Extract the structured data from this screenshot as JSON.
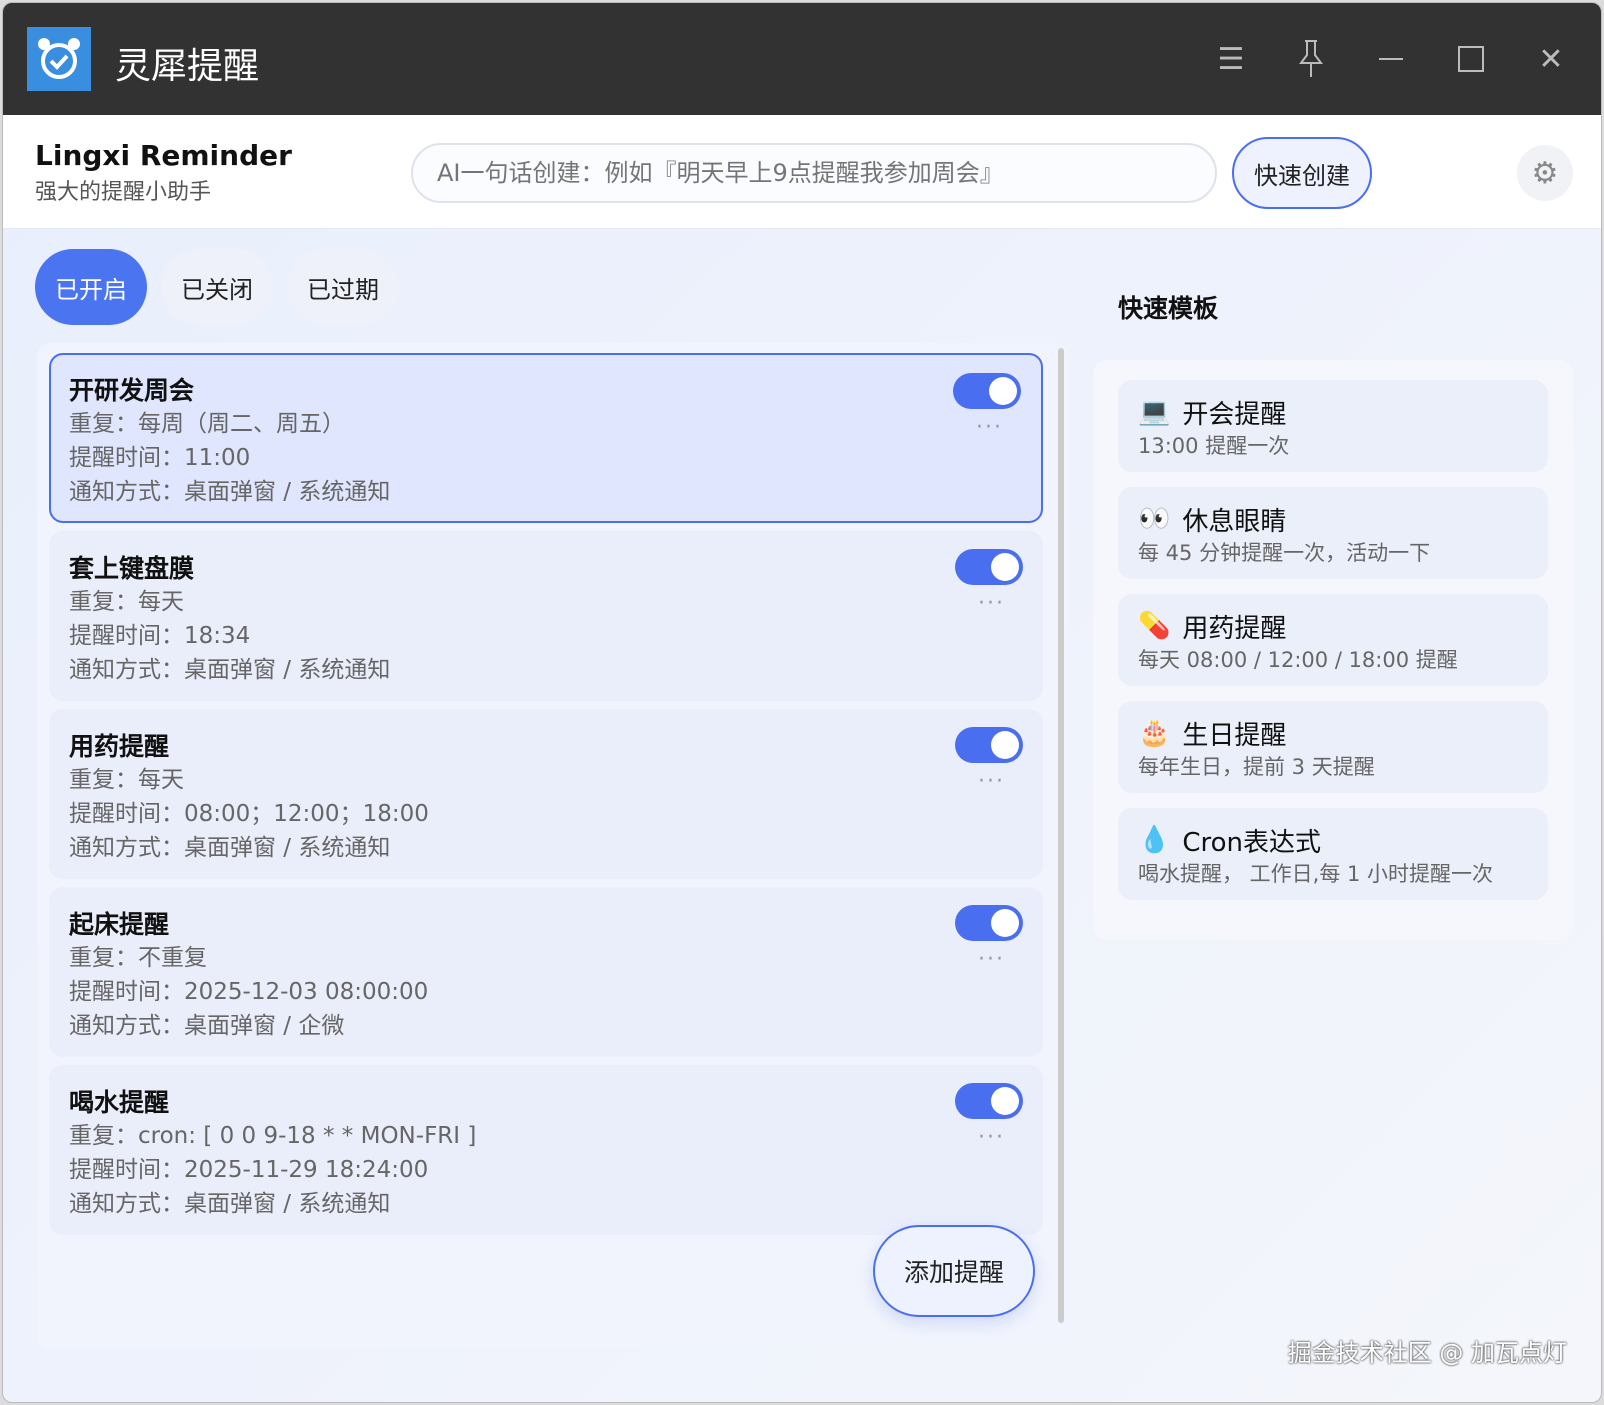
{
  "window": {
    "title": "灵犀提醒"
  },
  "header": {
    "brand": "Lingxi Reminder",
    "subtitle": "强大的提醒小助手",
    "ai_placeholder": "AI一句话创建：例如『明天早上9点提醒我参加周会』",
    "quick_create": "快速创建"
  },
  "tabs": [
    {
      "label": "已开启",
      "active": true
    },
    {
      "label": "已关闭"
    },
    {
      "label": "已过期"
    }
  ],
  "reminders": [
    {
      "title": "开研发周会",
      "repeat": "重复：每周（周二、周五）",
      "time": "提醒时间：11:00",
      "notify": "通知方式：桌面弹窗 / 系统通知",
      "enabled": true,
      "selected": true
    },
    {
      "title": "套上键盘膜",
      "repeat": "重复：每天",
      "time": "提醒时间：18:34",
      "notify": "通知方式：桌面弹窗 / 系统通知",
      "enabled": true
    },
    {
      "title": "用药提醒",
      "repeat": "重复：每天",
      "time": "提醒时间：08:00；12:00；18:00",
      "notify": "通知方式：桌面弹窗 / 系统通知",
      "enabled": true
    },
    {
      "title": "起床提醒",
      "repeat": "重复：不重复",
      "time": "提醒时间：2025-12-03 08:00:00",
      "notify": "通知方式：桌面弹窗 / 企微",
      "enabled": true
    },
    {
      "title": "喝水提醒",
      "repeat": "重复：cron: [ 0 0 9-18 * * MON-FRI ]",
      "time": "提醒时间：2025-11-29 18:24:00",
      "notify": "通知方式：桌面弹窗 / 系统通知",
      "enabled": true
    }
  ],
  "more_label": "···",
  "add_button": "添加提醒",
  "templates": {
    "title": "快速模板",
    "items": [
      {
        "icon": "💻",
        "name": "开会提醒",
        "desc": "13:00 提醒一次"
      },
      {
        "icon": "👀",
        "name": "休息眼睛",
        "desc": "每 45 分钟提醒一次，活动一下"
      },
      {
        "icon": "💊",
        "name": "用药提醒",
        "desc": "每天 08:00 / 12:00 / 18:00 提醒"
      },
      {
        "icon": "🎂",
        "name": "生日提醒",
        "desc": "每年生日，提前 3 天提醒"
      },
      {
        "icon": "💧",
        "name": "Cron表达式",
        "desc": "喝水提醒，  工作日,每 1 小时提醒一次"
      }
    ]
  },
  "watermark": "掘金技术社区 @ 加瓦点灯",
  "colors": {
    "accent": "#4a6ef0",
    "titlebar": "#323232"
  }
}
